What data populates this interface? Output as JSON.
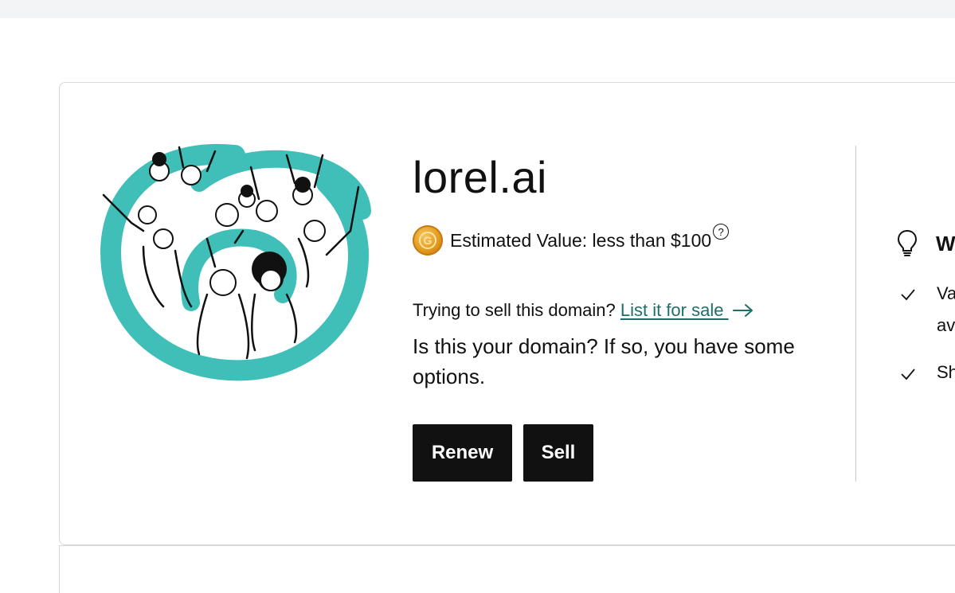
{
  "domain": {
    "name": "lorel.ai"
  },
  "valuation": {
    "label": "Estimated Value: less than $100",
    "coin_letter": "G",
    "help_symbol": "?"
  },
  "sell_prompt": {
    "text": "Trying to sell this domain? ",
    "link_label": "List it for sale "
  },
  "ownership": {
    "text": "Is this your domain? If so, you have some options."
  },
  "actions": {
    "renew_label": "Renew",
    "sell_label": "Sell"
  },
  "right_panel": {
    "heading": "W",
    "items": [
      {
        "line1": "Va",
        "line2": "av"
      },
      {
        "line1": "Sh"
      }
    ]
  },
  "colors": {
    "accent_teal": "#3fbfb8",
    "link": "#1d6f6a",
    "button_bg": "#111111",
    "coin": "#e39a1d"
  }
}
